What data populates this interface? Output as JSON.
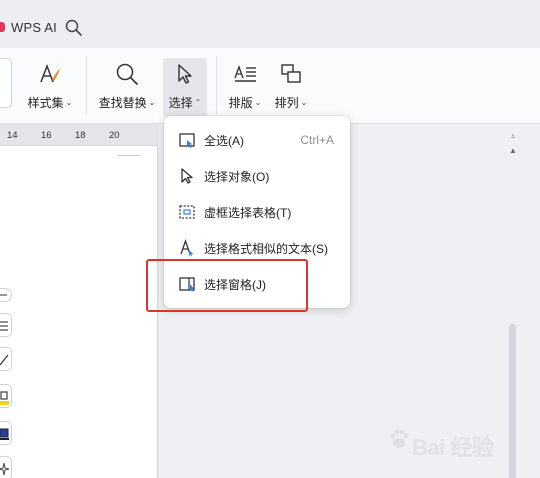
{
  "titlebar": {
    "brand": "WPS AI"
  },
  "ribbon": {
    "style_set_label": "样式集",
    "find_replace_label": "查找替换",
    "select_label": "选择",
    "layout_label": "排版",
    "arrange_label": "排列",
    "caret": "⌄"
  },
  "ruler": {
    "ticks": [
      "14",
      "16",
      "18",
      "20"
    ]
  },
  "menu": {
    "items": [
      {
        "label": "全选(A)",
        "shortcut": "Ctrl+A"
      },
      {
        "label": "选择对象(O)"
      },
      {
        "label": "虚框选择表格(T)"
      },
      {
        "label": "选择格式相似的文本(S)"
      },
      {
        "label": "选择窗格(J)"
      }
    ]
  },
  "watermark": {
    "text": "Bai 经验"
  },
  "colors": {
    "highlight": "#d9362b",
    "accent": "#3a7bf0",
    "brand": "#e2375a"
  }
}
